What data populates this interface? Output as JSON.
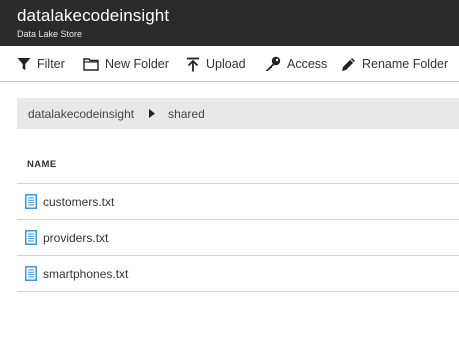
{
  "header": {
    "title": "datalakecodeinsight",
    "subtitle": "Data Lake Store"
  },
  "toolbar": {
    "filter_label": "Filter",
    "new_folder_label": "New Folder",
    "upload_label": "Upload",
    "access_label": "Access",
    "rename_folder_label": "Rename Folder"
  },
  "breadcrumb": {
    "root": "datalakecodeinsight",
    "current": "shared"
  },
  "table": {
    "column_name": "NAME",
    "rows": [
      {
        "name": "customers.txt",
        "icon": "text-file-icon"
      },
      {
        "name": "providers.txt",
        "icon": "text-file-icon"
      },
      {
        "name": "smartphones.txt",
        "icon": "text-file-icon"
      }
    ]
  },
  "colors": {
    "header_bg": "#2b2b2b",
    "breadcrumb_bg": "#e8e8e8",
    "file_icon": "#3a96dd"
  }
}
